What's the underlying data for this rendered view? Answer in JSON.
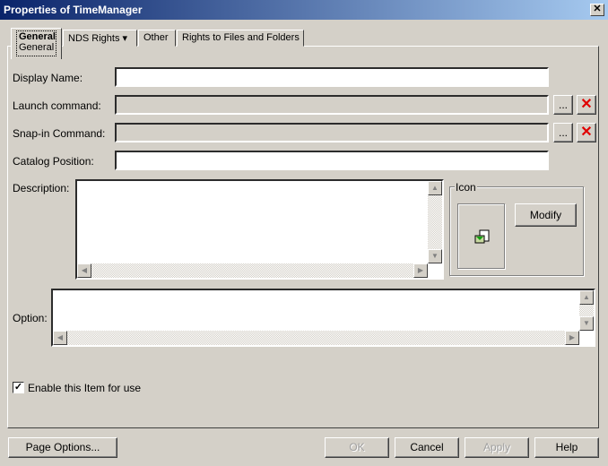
{
  "window": {
    "title": "Properties of TimeManager",
    "close": "✕"
  },
  "tabs": [
    {
      "label": "General",
      "sublabel": "General"
    },
    {
      "label": "NDS Rights ▾"
    },
    {
      "label": "Other"
    },
    {
      "label": "Rights to Files and Folders"
    }
  ],
  "fields": {
    "display_name": {
      "label": "Display Name:",
      "value": ""
    },
    "launch_command": {
      "label": "Launch command:",
      "value": ""
    },
    "snapin_command": {
      "label": "Snap-in Command:",
      "value": ""
    },
    "catalog_position": {
      "label": "Catalog Position:",
      "value": ""
    },
    "description": {
      "label": "Description:",
      "value": ""
    },
    "option": {
      "label": "Option:",
      "value": ""
    }
  },
  "browse_label": "...",
  "clear_label": "✕",
  "icon_group": {
    "label": "Icon",
    "modify": "Modify"
  },
  "enable_checkbox": {
    "label": "Enable this Item for use",
    "checked": true,
    "mark": "✓"
  },
  "buttons": {
    "page_options": "Page Options...",
    "ok": "OK",
    "cancel": "Cancel",
    "apply": "Apply",
    "help": "Help"
  },
  "arrows": {
    "up": "▲",
    "down": "▼",
    "left": "◀",
    "right": "▶"
  }
}
